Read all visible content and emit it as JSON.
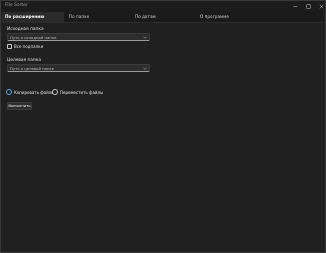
{
  "window": {
    "title": "File Sorter"
  },
  "tabs": [
    {
      "label": "По расширению",
      "active": true
    },
    {
      "label": "По папке",
      "active": false
    },
    {
      "label": "По датам",
      "active": false
    },
    {
      "label": "О программе",
      "active": false
    }
  ],
  "source": {
    "label": "Исходная папка",
    "placeholder": "Путь к исходной папке",
    "value": ""
  },
  "subfolders": {
    "label": "Все подпапки",
    "checked": false
  },
  "target": {
    "label": "Целевая папка",
    "placeholder": "Путь к целевой папке",
    "value": ""
  },
  "mode": {
    "copy_label": "Копировать файлы",
    "move_label": "Переместить файлы",
    "selected": "copy"
  },
  "actions": {
    "run_label": "Выполнить"
  },
  "colors": {
    "background": "#202020",
    "accent": "#5aa9ff",
    "tab_active": "#2b2b2b"
  },
  "icons": {
    "minimize": "minimize-icon",
    "maximize": "maximize-icon",
    "close": "close-icon",
    "dropdown": "chevron-down-icon"
  }
}
